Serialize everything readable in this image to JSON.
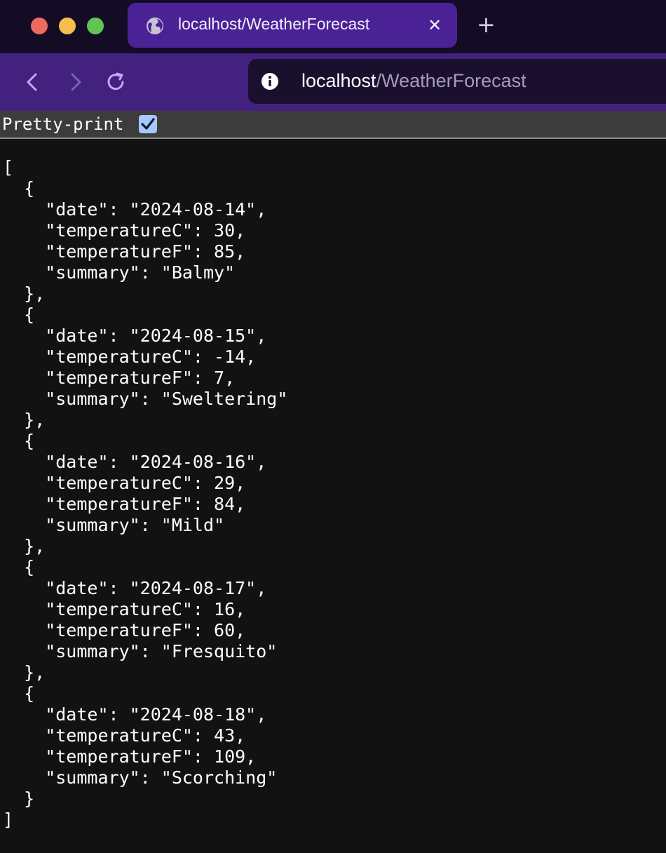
{
  "browser": {
    "tab_title": "localhost/WeatherForecast",
    "url_host": "localhost",
    "url_path": "/WeatherForecast",
    "icons": {
      "close": "close-icon",
      "new_tab": "plus-icon",
      "back": "chevron-left-icon",
      "forward": "chevron-right-icon",
      "reload": "reload-icon",
      "site_info": "info-icon",
      "tab_favicon": "globe-icon"
    },
    "colors": {
      "tabbar_bg": "#140b25",
      "active_tab": "#4b2296",
      "toolbar_bg": "#43227f",
      "url_bg": "#1b0f2e"
    }
  },
  "viewer": {
    "pretty_print_label": "Pretty-print",
    "pretty_print_checked": true
  },
  "forecasts": [
    {
      "date": "2024-08-14",
      "temperatureC": 30,
      "temperatureF": 85,
      "summary": "Balmy"
    },
    {
      "date": "2024-08-15",
      "temperatureC": -14,
      "temperatureF": 7,
      "summary": "Sweltering"
    },
    {
      "date": "2024-08-16",
      "temperatureC": 29,
      "temperatureF": 84,
      "summary": "Mild"
    },
    {
      "date": "2024-08-17",
      "temperatureC": 16,
      "temperatureF": 60,
      "summary": "Fresquito"
    },
    {
      "date": "2024-08-18",
      "temperatureC": 43,
      "temperatureF": 109,
      "summary": "Scorching"
    }
  ]
}
